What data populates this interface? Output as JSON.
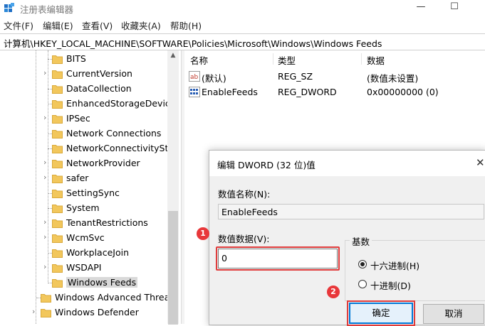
{
  "window": {
    "title": "注册表编辑器",
    "minimize_glyph": "—",
    "maximize_glyph": "☐"
  },
  "menu": [
    "文件(F)",
    "编辑(E)",
    "查看(V)",
    "收藏夹(A)",
    "帮助(H)"
  ],
  "address": "计算机\\HKEY_LOCAL_MACHINE\\SOFTWARE\\Policies\\Microsoft\\Windows\\Windows Feeds",
  "tree": {
    "items": [
      {
        "label": "BITS",
        "expandable": false
      },
      {
        "label": "CurrentVersion",
        "expandable": true
      },
      {
        "label": "DataCollection",
        "expandable": false
      },
      {
        "label": "EnhancedStorageDevice",
        "expandable": false
      },
      {
        "label": "IPSec",
        "expandable": true
      },
      {
        "label": "Network Connections",
        "expandable": false
      },
      {
        "label": "NetworkConnectivitySta",
        "expandable": false
      },
      {
        "label": "NetworkProvider",
        "expandable": true
      },
      {
        "label": "safer",
        "expandable": true
      },
      {
        "label": "SettingSync",
        "expandable": false
      },
      {
        "label": "System",
        "expandable": false
      },
      {
        "label": "TenantRestrictions",
        "expandable": true
      },
      {
        "label": "WcmSvc",
        "expandable": true
      },
      {
        "label": "WorkplaceJoin",
        "expandable": false
      },
      {
        "label": "WSDAPI",
        "expandable": true
      },
      {
        "label": "Windows Feeds",
        "expandable": false,
        "selected": true
      }
    ],
    "parent_items": [
      {
        "label": "Windows Advanced Threa",
        "expandable": false
      },
      {
        "label": "Windows Defender",
        "expandable": true
      }
    ]
  },
  "list": {
    "columns": [
      "名称",
      "类型",
      "数据"
    ],
    "rows": [
      {
        "icon": "string-value-icon",
        "name": "(默认)",
        "type": "REG_SZ",
        "data": "(数值未设置)"
      },
      {
        "icon": "dword-value-icon",
        "name": "EnableFeeds",
        "type": "REG_DWORD",
        "data": "0x00000000 (0)"
      }
    ]
  },
  "dialog": {
    "title": "编辑 DWORD (32 位)值",
    "close_glyph": "✕",
    "name_label": "数值名称(N):",
    "name_value": "EnableFeeds",
    "data_label": "数值数据(V):",
    "data_value": "0",
    "base_label": "基数",
    "radio_hex": "十六进制(H)",
    "radio_dec": "十进制(D)",
    "hex_selected": true,
    "ok_label": "确定",
    "cancel_label": "取消"
  },
  "badges": {
    "step1": "1",
    "step2": "2"
  },
  "colors": {
    "highlight": "#e03c3c",
    "badge": "#e8373a",
    "focus": "#0078d7",
    "folder": "#f2c75c"
  }
}
